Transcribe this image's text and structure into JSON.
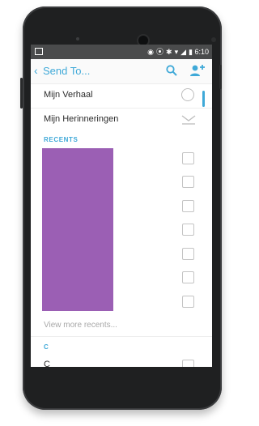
{
  "status_bar": {
    "time": "6:10",
    "icons": [
      "hotspot-icon",
      "location-icon",
      "bluetooth-icon",
      "wifi-icon",
      "signal-icon",
      "battery-icon"
    ]
  },
  "header": {
    "back_glyph": "‹",
    "title": "Send To..."
  },
  "rows": {
    "my_story": "Mijn Verhaal",
    "my_memories": "Mijn Herinneringen"
  },
  "recents": {
    "header": "RECENTS",
    "checkbox_count": 7,
    "view_more": "View more recents..."
  },
  "alphabet_section": {
    "letter": "C",
    "partial_row": "C"
  },
  "colors": {
    "accent": "#3fa9d8",
    "redaction": "#9b5fb4",
    "device": "#1f2021"
  }
}
